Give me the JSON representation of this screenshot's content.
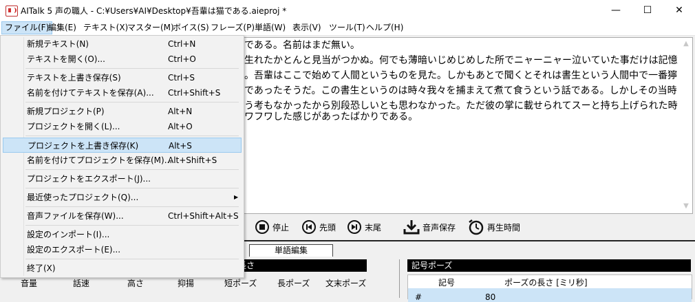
{
  "window": {
    "title": "AITalk 5 声の職人 - C:¥Users¥AI¥Desktop¥吾輩は猫である.aieproj *",
    "minimize": "—",
    "maximize": "☐",
    "close": "✕"
  },
  "menubar": [
    "ファイル(F)",
    "編集(E)",
    "テキスト(X)",
    "マスター(M)",
    "ボイス(S)",
    "フレーズ(P)",
    "単語(W)",
    "表示(V)",
    "ツール(T)",
    "ヘルプ(H)"
  ],
  "file_menu": [
    {
      "label": "新規テキスト(N)",
      "shortcut": "Ctrl+N"
    },
    {
      "label": "テキストを開く(O)...",
      "shortcut": "Ctrl+O"
    },
    {
      "label": "テキストを上書き保存(S)",
      "shortcut": "Ctrl+S"
    },
    {
      "label": "名前を付けてテキストを保存(A)...",
      "shortcut": "Ctrl+Shift+S"
    },
    {
      "label": "新規プロジェクト(P)",
      "shortcut": "Alt+N"
    },
    {
      "label": "プロジェクトを開く(L)...",
      "shortcut": "Alt+O"
    },
    {
      "label": "プロジェクトを上書き保存(K)",
      "shortcut": "Alt+S"
    },
    {
      "label": "名前を付けてプロジェクトを保存(M)...",
      "shortcut": "Alt+Shift+S"
    },
    {
      "label": "プロジェクトをエクスポート(J)...",
      "shortcut": ""
    },
    {
      "label": "最近使ったプロジェクト(Q)...",
      "shortcut": "",
      "submenu_arrow": "▶"
    },
    {
      "label": "音声ファイルを保存(W)...",
      "shortcut": "Ctrl+Shift+Alt+S"
    },
    {
      "label": "設定のインポート(I)...",
      "shortcut": ""
    },
    {
      "label": "設定のエクスポート(E)...",
      "shortcut": ""
    },
    {
      "label": "終了(X)",
      "shortcut": ""
    }
  ],
  "editor_lines": [
    "である。名前はまだ無い。",
    "生れたかとんと見当がつかぬ。何でも薄暗いじめじめした所でニャーニャー泣いていた事だけは記憶",
    "。吾輩はここで始めて人間というものを見た。しかもあとで聞くとそれは書生という人間中で一番獰",
    "であったそうだ。この書生というのは時々我々を捕まえて煮て食うという話である。しかしその当時",
    "う考もなかったから別段恐しいとも思わなかった。ただ彼の掌に載せられてスーと持ち上げられた時",
    "ワフワした感じがあったばかりである。"
  ],
  "player": {
    "stop": "停止",
    "head": "先頭",
    "end": "末尾",
    "save_audio": "音声保存",
    "play_time": "再生時間"
  },
  "tabs": {
    "word_edit": "単語編集"
  },
  "params": {
    "header": "長さ",
    "labels": [
      "音量",
      "話速",
      "高さ",
      "抑揚",
      "短ポーズ",
      "長ポーズ",
      "文末ポーズ"
    ]
  },
  "symbol_pause": {
    "header": "記号ポーズ",
    "col_symbol": "記号",
    "col_length": "ポーズの長さ [ミリ秒]",
    "rows": [
      {
        "symbol": "#",
        "length": "80"
      }
    ]
  }
}
